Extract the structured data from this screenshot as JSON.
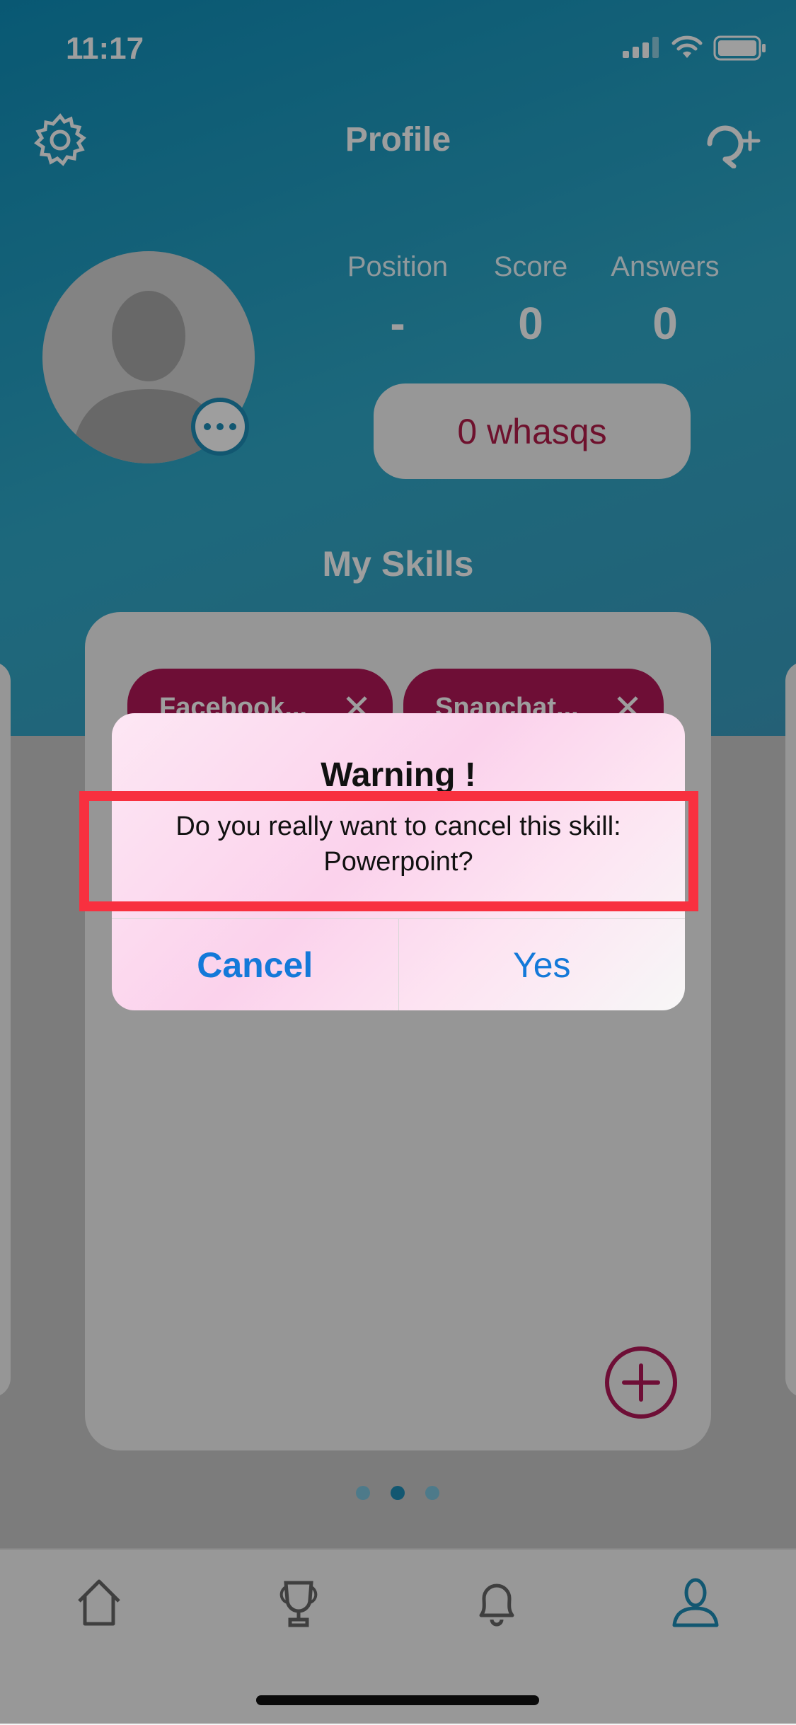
{
  "status_bar": {
    "time": "11:17"
  },
  "header": {
    "title": "Profile"
  },
  "stats": [
    {
      "label": "Position",
      "value": "-"
    },
    {
      "label": "Score",
      "value": "0"
    },
    {
      "label": "Answers",
      "value": "0"
    }
  ],
  "whasqs_label": "0 whasqs",
  "skills": {
    "title": "My Skills",
    "chips": [
      {
        "label": "Facebook..."
      },
      {
        "label": "Snapchat..."
      }
    ],
    "chip_remove_icon": "close-icon",
    "add_icon": "plus-circle-icon"
  },
  "page_indicator": {
    "count": 3,
    "active_index": 1
  },
  "tabbar": {
    "items": [
      {
        "icon": "home-icon"
      },
      {
        "icon": "trophy-icon"
      },
      {
        "icon": "bell-icon"
      },
      {
        "icon": "profile-icon",
        "active": true
      }
    ],
    "active_color": "#1d8db6",
    "inactive_color": "#666666"
  },
  "dialog": {
    "title": "Warning !",
    "message": "Do you really want to cancel this skill: Powerpoint?",
    "cancel_label": "Cancel",
    "yes_label": "Yes"
  },
  "colors": {
    "accent": "#1d8db6",
    "chip": "#b21758",
    "whasqs_text": "#b21c4a",
    "highlight": "#f8303f",
    "link": "#1479d9"
  }
}
